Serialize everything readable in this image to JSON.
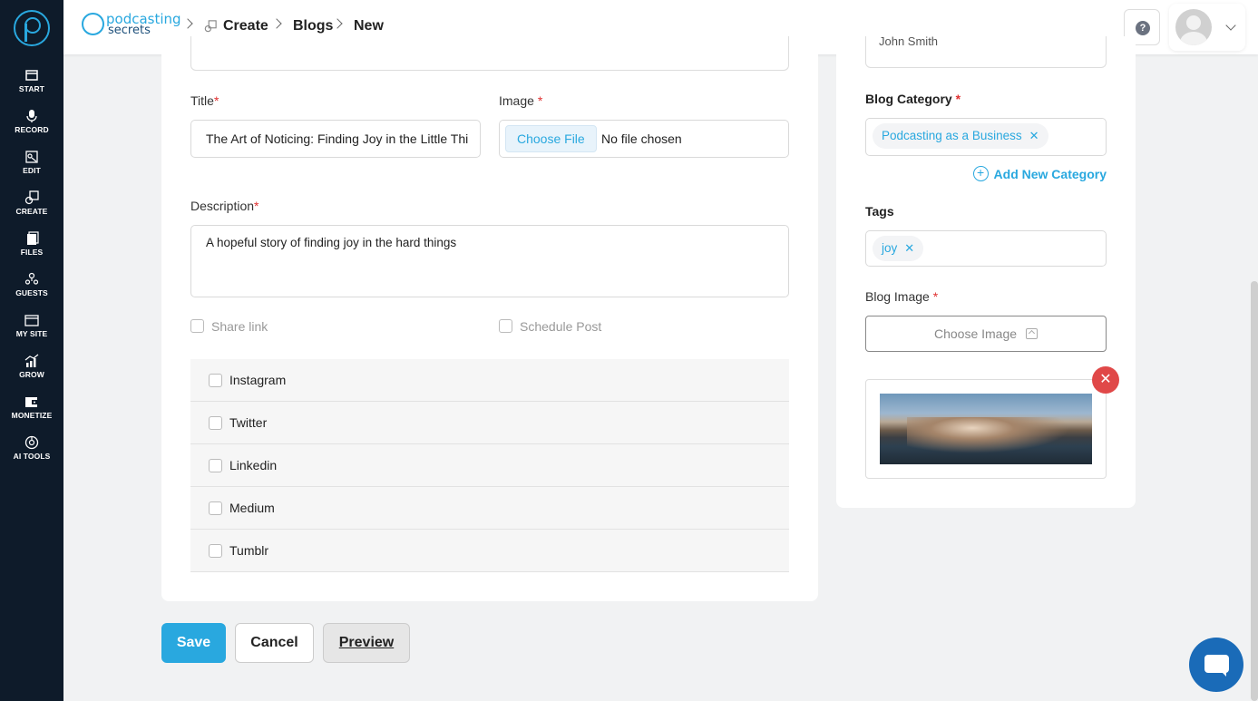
{
  "header": {
    "brand_line1": "podcasting",
    "brand_line2": "secrets",
    "breadcrumb": [
      "Create",
      "Blogs",
      "New"
    ]
  },
  "sidebar": {
    "items": [
      {
        "label": "START",
        "icon": "start-icon"
      },
      {
        "label": "RECORD",
        "icon": "microphone-icon"
      },
      {
        "label": "EDIT",
        "icon": "edit-icon"
      },
      {
        "label": "CREATE",
        "icon": "create-icon"
      },
      {
        "label": "FILES",
        "icon": "files-icon"
      },
      {
        "label": "GUESTS",
        "icon": "guests-icon"
      },
      {
        "label": "MY SITE",
        "icon": "my-site-icon"
      },
      {
        "label": "GROW",
        "icon": "grow-icon"
      },
      {
        "label": "MONETIZE",
        "icon": "monetize-icon"
      },
      {
        "label": "AI TOOLS",
        "icon": "ai-tools-icon"
      }
    ]
  },
  "form": {
    "title_label": "Title",
    "title_value": "The Art of Noticing: Finding Joy in the Little Thi",
    "image_label": "Image",
    "choose_file": "Choose File",
    "no_file": "No file chosen",
    "description_label": "Description",
    "description_value": "A hopeful story of finding joy in the hard things",
    "share_link": "Share link",
    "schedule_post": "Schedule Post",
    "socials": [
      "Instagram",
      "Twitter",
      "Linkedin",
      "Medium",
      "Tumblr"
    ],
    "required_mark": "*"
  },
  "actions": {
    "save": "Save",
    "cancel": "Cancel",
    "preview": "Preview"
  },
  "right_panel": {
    "author_value": "John Smith",
    "category_label": "Blog Category",
    "category_chip": "Podcasting as a Business",
    "add_category": "Add New Category",
    "tags_label": "Tags",
    "tag_chip": "joy",
    "blog_image_label": "Blog Image",
    "choose_image": "Choose Image"
  },
  "colors": {
    "accent": "#29a8df",
    "sidebar_bg": "#0e1b2a",
    "required": "#e03131",
    "remove": "#e04848",
    "chat": "#1a6bb8"
  }
}
